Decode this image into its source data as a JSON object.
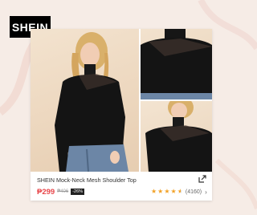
{
  "brand": {
    "logo_text": "SHEIN"
  },
  "product": {
    "title": "SHEIN Mock-Neck Mesh Shoulder Top",
    "price": "₱299",
    "original_price": "₱406",
    "discount": "-26%",
    "rating_count": "(4160)",
    "rating_stars": 4.5
  },
  "icons": {
    "share": "share-arrow-icon",
    "chevron": "chevron-right-icon",
    "star": "star-icon"
  },
  "colors": {
    "background": "#f6ece6",
    "price": "#e8464a",
    "star": "#f2a227",
    "logo_bg": "#000000"
  }
}
